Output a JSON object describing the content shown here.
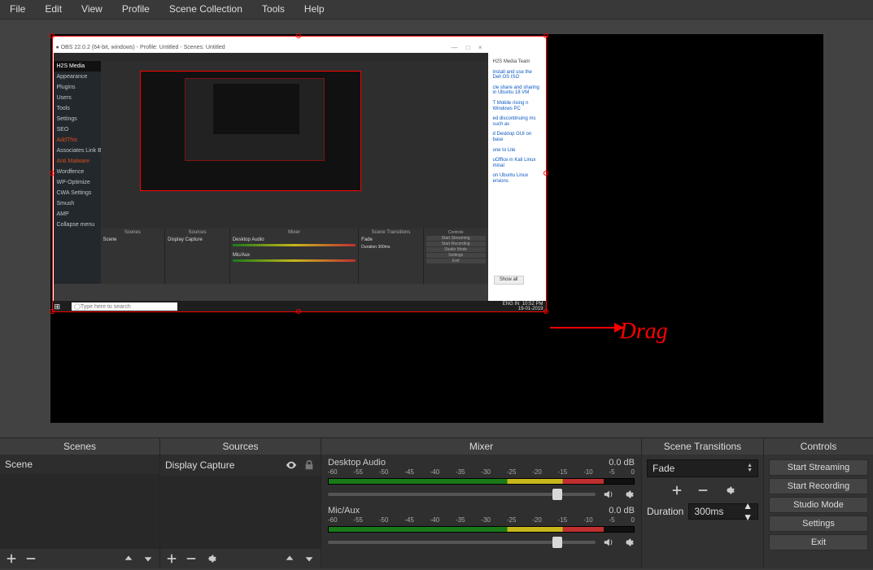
{
  "menubar": [
    "File",
    "Edit",
    "View",
    "Profile",
    "Scene Collection",
    "Tools",
    "Help"
  ],
  "preview": {
    "annotation_text": "Drag",
    "taskbar_search_placeholder": "Type here to search",
    "nested_title": "OBS 22.0.2 (64-bit, windows) - Profile: Untitled - Scenes: Untitled",
    "nested_sidebar_items": [
      "H2S Media",
      "Appearance",
      "Plugins",
      "Users",
      "Tools",
      "Settings",
      "SEO",
      "AddThis",
      "Associates Link Builder",
      "Anti Malware",
      "Wordfence",
      "WP-Optimize",
      "CWA Settings",
      "Smush",
      "AMP",
      "Collapse menu"
    ],
    "nested_right_links": [
      "H2S Media Team",
      "install and use the Dell OS ISO",
      "cle share and sharing in Ubuntu 18 VM",
      "T Mobile rising n Windows PC",
      "ed discontinuing ms such as",
      "d Desktop GUI on base",
      "one to Lite",
      "uOffice in Kali Linux minal",
      "on Ubuntu Linux ersions"
    ],
    "nested_show_all": "Show all",
    "nested_time": "10:52 PM",
    "nested_date": "19-01-2019",
    "nested_lang": "ENG IN"
  },
  "panels": {
    "scenes": {
      "title": "Scenes",
      "items": [
        "Scene"
      ]
    },
    "sources": {
      "title": "Sources",
      "items": [
        {
          "label": "Display Capture",
          "visible": true,
          "locked": false
        }
      ]
    },
    "mixer": {
      "title": "Mixer",
      "channels": [
        {
          "name": "Desktop Audio",
          "db": "0.0 dB",
          "ticks": [
            "-60",
            "-55",
            "-50",
            "-45",
            "-40",
            "-35",
            "-30",
            "-25",
            "-20",
            "-15",
            "-10",
            "-5",
            "0"
          ],
          "fill_pct": 90,
          "thumb_pct": 84
        },
        {
          "name": "Mic/Aux",
          "db": "0.0 dB",
          "ticks": [
            "-60",
            "-55",
            "-50",
            "-45",
            "-40",
            "-35",
            "-30",
            "-25",
            "-20",
            "-15",
            "-10",
            "-5",
            "0"
          ],
          "fill_pct": 90,
          "thumb_pct": 84
        }
      ]
    },
    "transitions": {
      "title": "Scene Transitions",
      "selected": "Fade",
      "duration_label": "Duration",
      "duration_value": "300ms"
    },
    "controls": {
      "title": "Controls",
      "buttons": [
        "Start Streaming",
        "Start Recording",
        "Studio Mode",
        "Settings",
        "Exit"
      ]
    }
  }
}
